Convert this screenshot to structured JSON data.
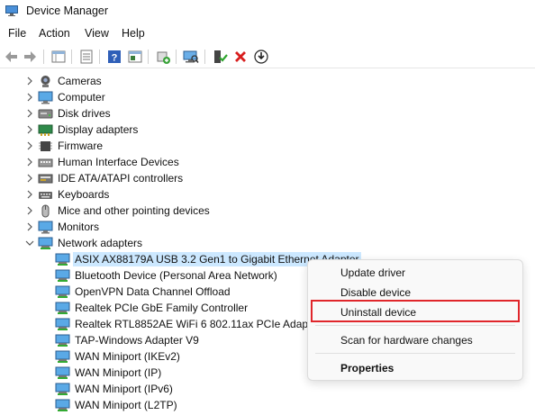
{
  "window": {
    "title": "Device Manager"
  },
  "menu": [
    "File",
    "Action",
    "View",
    "Help"
  ],
  "toolbar_icons": [
    "back-arrow-icon",
    "forward-arrow-icon",
    "properties-sheet-icon",
    "show-hidden-icon",
    "help-icon",
    "action-pane-icon",
    "update-driver-icon",
    "scan-hardware-icon",
    "enable-device-icon",
    "uninstall-x-icon",
    "download-driver-icon"
  ],
  "tree": {
    "categories": [
      {
        "label": "Cameras",
        "icon": "camera-icon",
        "expanded": false
      },
      {
        "label": "Computer",
        "icon": "monitor-icon",
        "expanded": false
      },
      {
        "label": "Disk drives",
        "icon": "disk-drive-icon",
        "expanded": false
      },
      {
        "label": "Display adapters",
        "icon": "display-adapter-icon",
        "expanded": false
      },
      {
        "label": "Firmware",
        "icon": "firmware-icon",
        "expanded": false
      },
      {
        "label": "Human Interface Devices",
        "icon": "hid-icon",
        "expanded": false
      },
      {
        "label": "IDE ATA/ATAPI controllers",
        "icon": "ide-controller-icon",
        "expanded": false
      },
      {
        "label": "Keyboards",
        "icon": "keyboard-icon",
        "expanded": false
      },
      {
        "label": "Mice and other pointing devices",
        "icon": "mouse-icon",
        "expanded": false
      },
      {
        "label": "Monitors",
        "icon": "monitor-icon",
        "expanded": false
      },
      {
        "label": "Network adapters",
        "icon": "network-adapter-icon",
        "expanded": true
      }
    ],
    "network_children": [
      {
        "label": "ASIX AX88179A USB 3.2 Gen1 to Gigabit Ethernet Adapter",
        "selected": true
      },
      {
        "label": "Bluetooth Device (Personal Area Network)"
      },
      {
        "label": "OpenVPN Data Channel Offload"
      },
      {
        "label": "Realtek PCIe GbE Family Controller"
      },
      {
        "label": "Realtek RTL8852AE WiFi 6 802.11ax PCIe Adapter"
      },
      {
        "label": "TAP-Windows Adapter V9"
      },
      {
        "label": "WAN Miniport (IKEv2)"
      },
      {
        "label": "WAN Miniport (IP)"
      },
      {
        "label": "WAN Miniport (IPv6)"
      },
      {
        "label": "WAN Miniport (L2TP)"
      }
    ]
  },
  "context_menu": {
    "update": "Update driver",
    "disable": "Disable device",
    "uninstall": "Uninstall device",
    "scan": "Scan for hardware changes",
    "properties": "Properties",
    "highlight_color": "#e0262b"
  }
}
